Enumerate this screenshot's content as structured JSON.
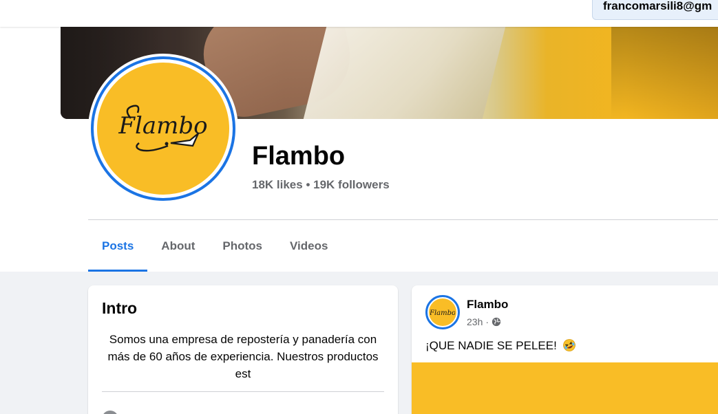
{
  "account": {
    "email_fragment": "francomarsili8@gm"
  },
  "page": {
    "name": "Flambo",
    "stats": "18K likes • 19K followers",
    "logo_text": "Flambo"
  },
  "tabs": [
    {
      "label": "Posts",
      "active": true
    },
    {
      "label": "About",
      "active": false
    },
    {
      "label": "Photos",
      "active": false
    },
    {
      "label": "Videos",
      "active": false
    }
  ],
  "intro": {
    "title": "Intro",
    "text": "Somos una empresa de repostería y panadería con más de 60 años de experiencia. Nuestros productos est"
  },
  "post": {
    "author": "Flambo",
    "time": "23h",
    "separator": "·",
    "text": "¡QUE NADIE SE PELEE!",
    "privacy_icon": "globe-icon",
    "emoji_icon": "rolling-laughing-emoji-icon"
  },
  "colors": {
    "accent": "#1b74e4",
    "brand_yellow": "#f9bd26",
    "background": "#f0f2f5"
  }
}
